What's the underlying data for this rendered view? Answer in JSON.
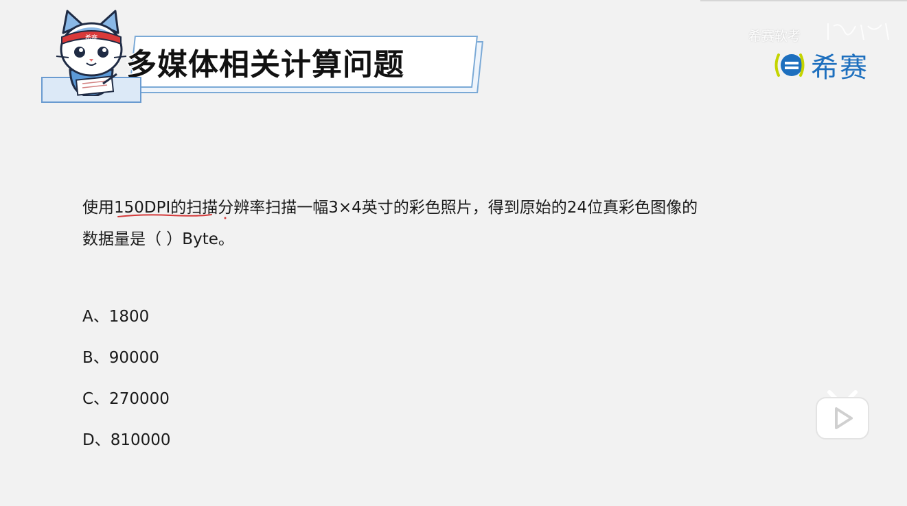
{
  "title": "多媒体相关计算问题",
  "mascot_badge": "希赛",
  "logo": {
    "watermark_text": "希赛软考",
    "brand_text": "希赛",
    "brand_color": "#1d6fbe"
  },
  "question": {
    "line1_prefix": "使用",
    "line1_highlight": "150DPI的扫描",
    "line1_suffix": "分辨率扫描一幅3×4英寸的彩色照片，得到原始的24位真彩色图像的",
    "line2": "数据量是（ ）Byte。"
  },
  "options": [
    {
      "label": "A、1800"
    },
    {
      "label": "B、90000"
    },
    {
      "label": "C、270000"
    },
    {
      "label": "D、810000"
    }
  ],
  "annotation_color": "#d43a3a",
  "play_icon": "play-icon"
}
